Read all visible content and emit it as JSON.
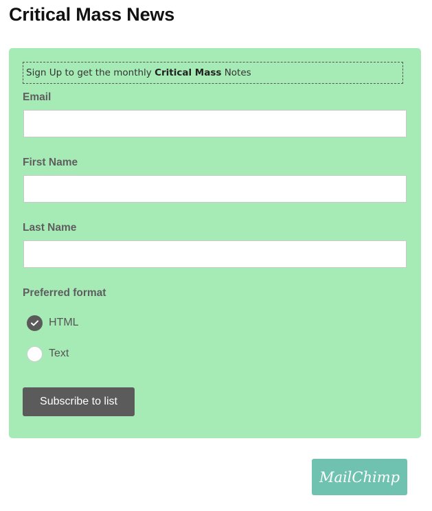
{
  "page": {
    "title": "Critical Mass News"
  },
  "form": {
    "intro_prefix": "Sign Up to get the monthly ",
    "intro_bold": "Critical Mass",
    "intro_suffix": " Notes",
    "fields": {
      "email": {
        "label": "Email",
        "value": "",
        "placeholder": ""
      },
      "first_name": {
        "label": "First Name",
        "value": "",
        "placeholder": ""
      },
      "last_name": {
        "label": "Last Name",
        "value": "",
        "placeholder": ""
      }
    },
    "format": {
      "label": "Preferred format",
      "options": [
        {
          "label": "HTML",
          "checked": true
        },
        {
          "label": "Text",
          "checked": false
        }
      ]
    },
    "submit_label": "Subscribe to list"
  },
  "badge": {
    "label": "MailChimp",
    "color": "#6fc2b0"
  },
  "colors": {
    "panel_bg": "#a6eab5",
    "button_bg": "#5b5b5b",
    "label_text": "#5e5e5e"
  }
}
